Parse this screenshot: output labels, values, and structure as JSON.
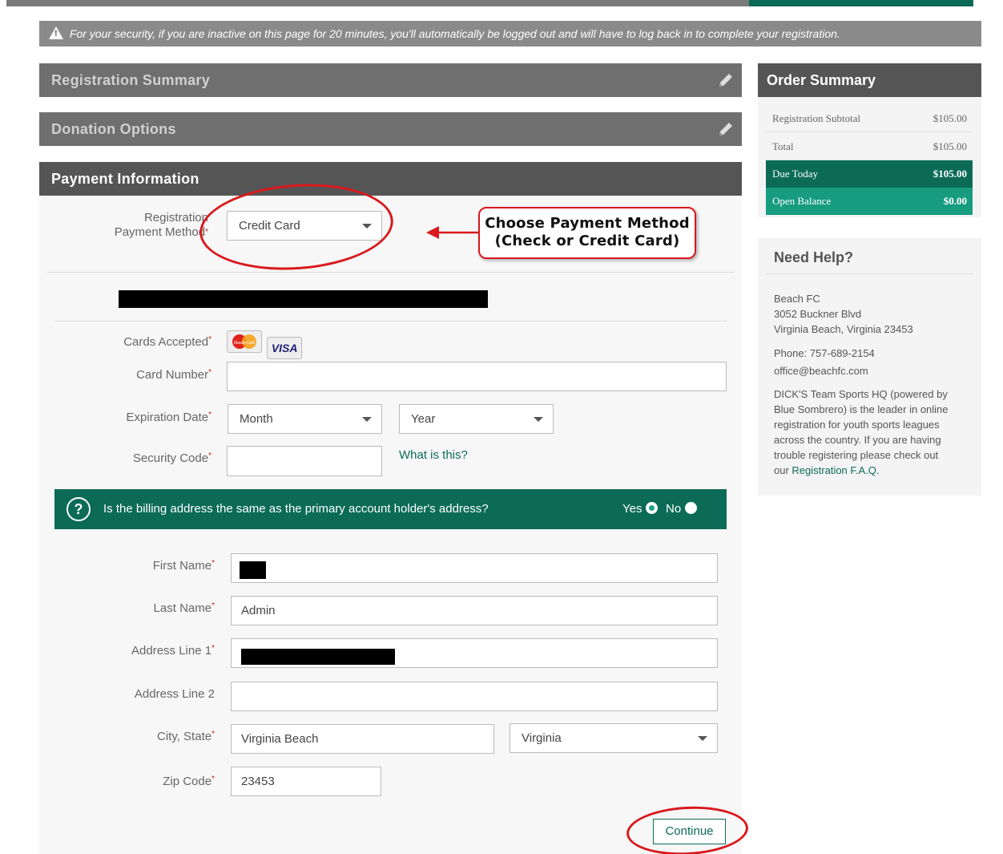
{
  "security_notice": "For your security, if you are inactive on this page for 20 minutes, you'll automatically be logged out and will have to log back in to complete your registration.",
  "sections": {
    "registration_summary": "Registration Summary",
    "donation_options": "Donation Options",
    "payment_information": "Payment Information"
  },
  "payment": {
    "method_label_line1": "Registration",
    "method_label_line2": "Payment Method",
    "method_value": "Credit Card",
    "cards_label": "Cards Accepted",
    "card_number_label": "Card Number",
    "card_number_value": "",
    "expiration_label": "Expiration Date",
    "month_value": "Month",
    "year_value": "Year",
    "security_code_label": "Security Code",
    "security_code_value": "",
    "what_is_this": "What is this?",
    "cards": {
      "mastercard": "MasterCard",
      "visa": "VISA"
    }
  },
  "annotation": {
    "line1": "Choose Payment Method",
    "line2": "(Check or Credit Card)"
  },
  "billing": {
    "question": "Is the billing address the same as the primary account holder's address?",
    "yes": "Yes",
    "no": "No",
    "selected": "Yes"
  },
  "address": {
    "first_name_label": "First Name",
    "last_name_label": "Last Name",
    "last_name_value": "Admin",
    "address1_label": "Address Line 1",
    "address2_label": "Address Line 2",
    "address2_value": "",
    "city_state_label": "City, State",
    "city_value": "Virginia Beach",
    "state_value": "Virginia",
    "zip_label": "Zip Code",
    "zip_value": "23453"
  },
  "continue_label": "Continue",
  "order_summary": {
    "title": "Order Summary",
    "rows": [
      {
        "label": "Registration Subtotal",
        "amount": "$105.00"
      },
      {
        "label": "Total",
        "amount": "$105.00"
      },
      {
        "label": "Due Today",
        "amount": "$105.00"
      },
      {
        "label": "Open Balance",
        "amount": "$0.00"
      }
    ]
  },
  "help": {
    "title": "Need Help?",
    "org": "Beach FC",
    "street": "3052 Buckner Blvd",
    "city": "Virginia Beach, Virginia 23453",
    "phone": "Phone: 757-689-2154",
    "email": "office@beachfc.com",
    "desc_lines": [
      "DICK'S Team Sports HQ (powered by",
      "Blue Sombrero) is the leader in online",
      "registration for youth sports leagues",
      "across the country. If you are having",
      "trouble registering please check out"
    ],
    "our": "our",
    "faq_link": "Registration F.A.Q."
  },
  "colors": {
    "accent": "#0b6b57",
    "accent_light": "#179c80",
    "header_gray": "#555555",
    "annotation_red": "#d9191c"
  }
}
